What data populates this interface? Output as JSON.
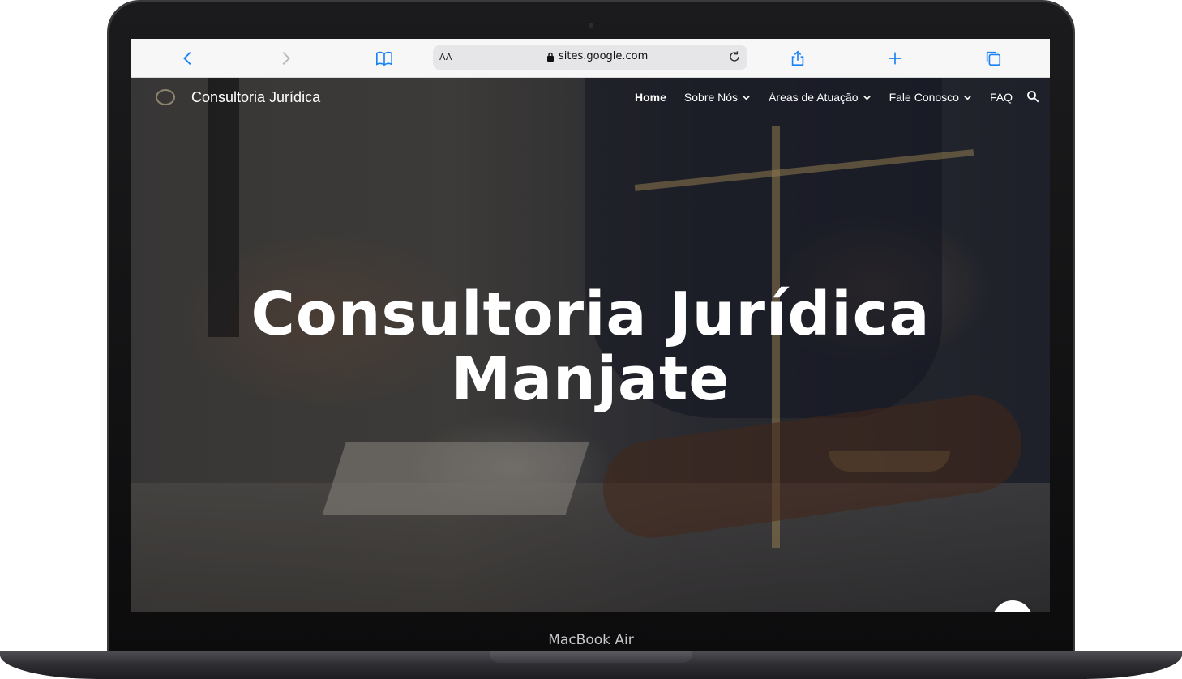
{
  "device": {
    "label": "MacBook Air"
  },
  "browser": {
    "text_size_label": "AA",
    "url": "sites.google.com",
    "icons": [
      "back-icon",
      "forward-icon",
      "bookmarks-icon",
      "lock-icon",
      "reload-icon",
      "share-icon",
      "new-tab-icon",
      "tabs-icon"
    ]
  },
  "site": {
    "title": "Consultoria Jurídica",
    "nav": [
      {
        "label": "Home",
        "active": true
      },
      {
        "label": "Sobre Nós",
        "dropdown": true
      },
      {
        "label": "Áreas de Atuação",
        "dropdown": true
      },
      {
        "label": "Fale Conosco",
        "dropdown": true
      },
      {
        "label": "FAQ"
      }
    ],
    "hero_title_line1": "Consultoria Jurídica",
    "hero_title_line2": "Manjate"
  },
  "colors": {
    "safari_accent": "#1a82f7",
    "toolbar_bg": "#f7f7f7"
  }
}
